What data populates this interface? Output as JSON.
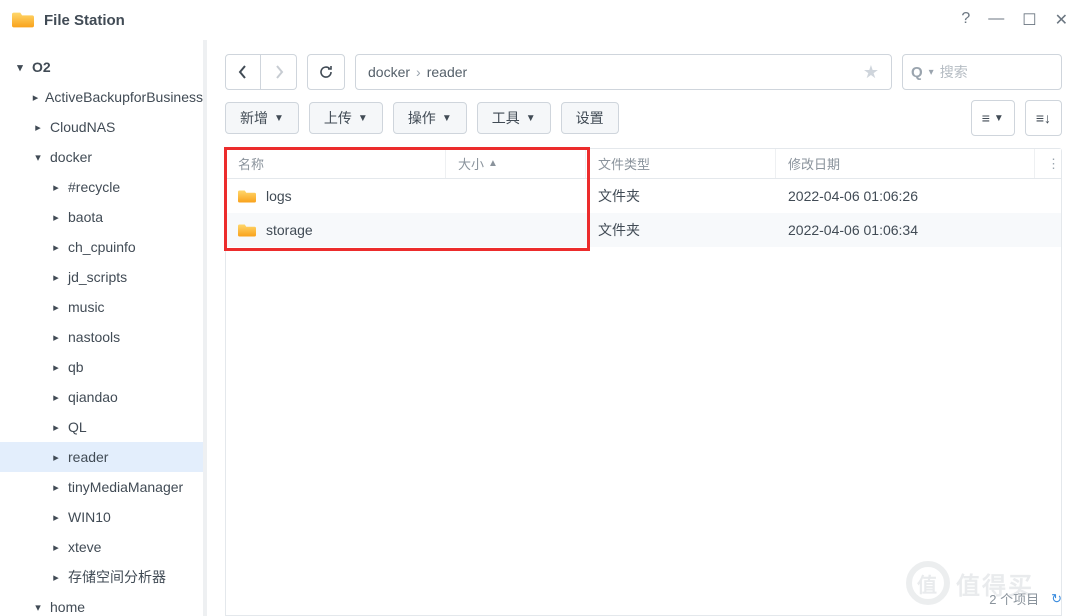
{
  "app": {
    "title": "File Station"
  },
  "window_controls": {
    "help": "?",
    "min": "—",
    "max": "☐",
    "close": "✕"
  },
  "tree": {
    "root": {
      "label": "O2",
      "expanded": true
    },
    "items": [
      {
        "label": "ActiveBackupforBusiness",
        "level": 1,
        "expanded": false
      },
      {
        "label": "CloudNAS",
        "level": 1,
        "expanded": false
      },
      {
        "label": "docker",
        "level": 1,
        "expanded": true
      },
      {
        "label": "#recycle",
        "level": 2,
        "expanded": false
      },
      {
        "label": "baota",
        "level": 2,
        "expanded": false
      },
      {
        "label": "ch_cpuinfo",
        "level": 2,
        "expanded": false
      },
      {
        "label": "jd_scripts",
        "level": 2,
        "expanded": false
      },
      {
        "label": "music",
        "level": 2,
        "expanded": false
      },
      {
        "label": "nastools",
        "level": 2,
        "expanded": false
      },
      {
        "label": "qb",
        "level": 2,
        "expanded": false
      },
      {
        "label": "qiandao",
        "level": 2,
        "expanded": false
      },
      {
        "label": "QL",
        "level": 2,
        "expanded": false
      },
      {
        "label": "reader",
        "level": 2,
        "expanded": false,
        "selected": true
      },
      {
        "label": "tinyMediaManager",
        "level": 2,
        "expanded": false
      },
      {
        "label": "WIN10",
        "level": 2,
        "expanded": false
      },
      {
        "label": "xteve",
        "level": 2,
        "expanded": false
      },
      {
        "label": "存储空间分析器",
        "level": 2,
        "expanded": false
      },
      {
        "label": "home",
        "level": 1,
        "expanded": true
      }
    ]
  },
  "breadcrumb": {
    "parts": [
      "docker",
      "reader"
    ],
    "sep": "›"
  },
  "search": {
    "placeholder": "搜索"
  },
  "toolbar": {
    "new": "新增",
    "upload": "上传",
    "action": "操作",
    "tools": "工具",
    "settings": "设置"
  },
  "columns": {
    "name": "名称",
    "size": "大小",
    "type": "文件类型",
    "date": "修改日期"
  },
  "rows": [
    {
      "name": "logs",
      "size": "",
      "type": "文件夹",
      "date": "2022-04-06 01:06:26"
    },
    {
      "name": "storage",
      "size": "",
      "type": "文件夹",
      "date": "2022-04-06 01:06:34"
    }
  ],
  "footer": {
    "count_text": "2 个项目",
    "refresh": "C"
  },
  "watermark": "值得买"
}
